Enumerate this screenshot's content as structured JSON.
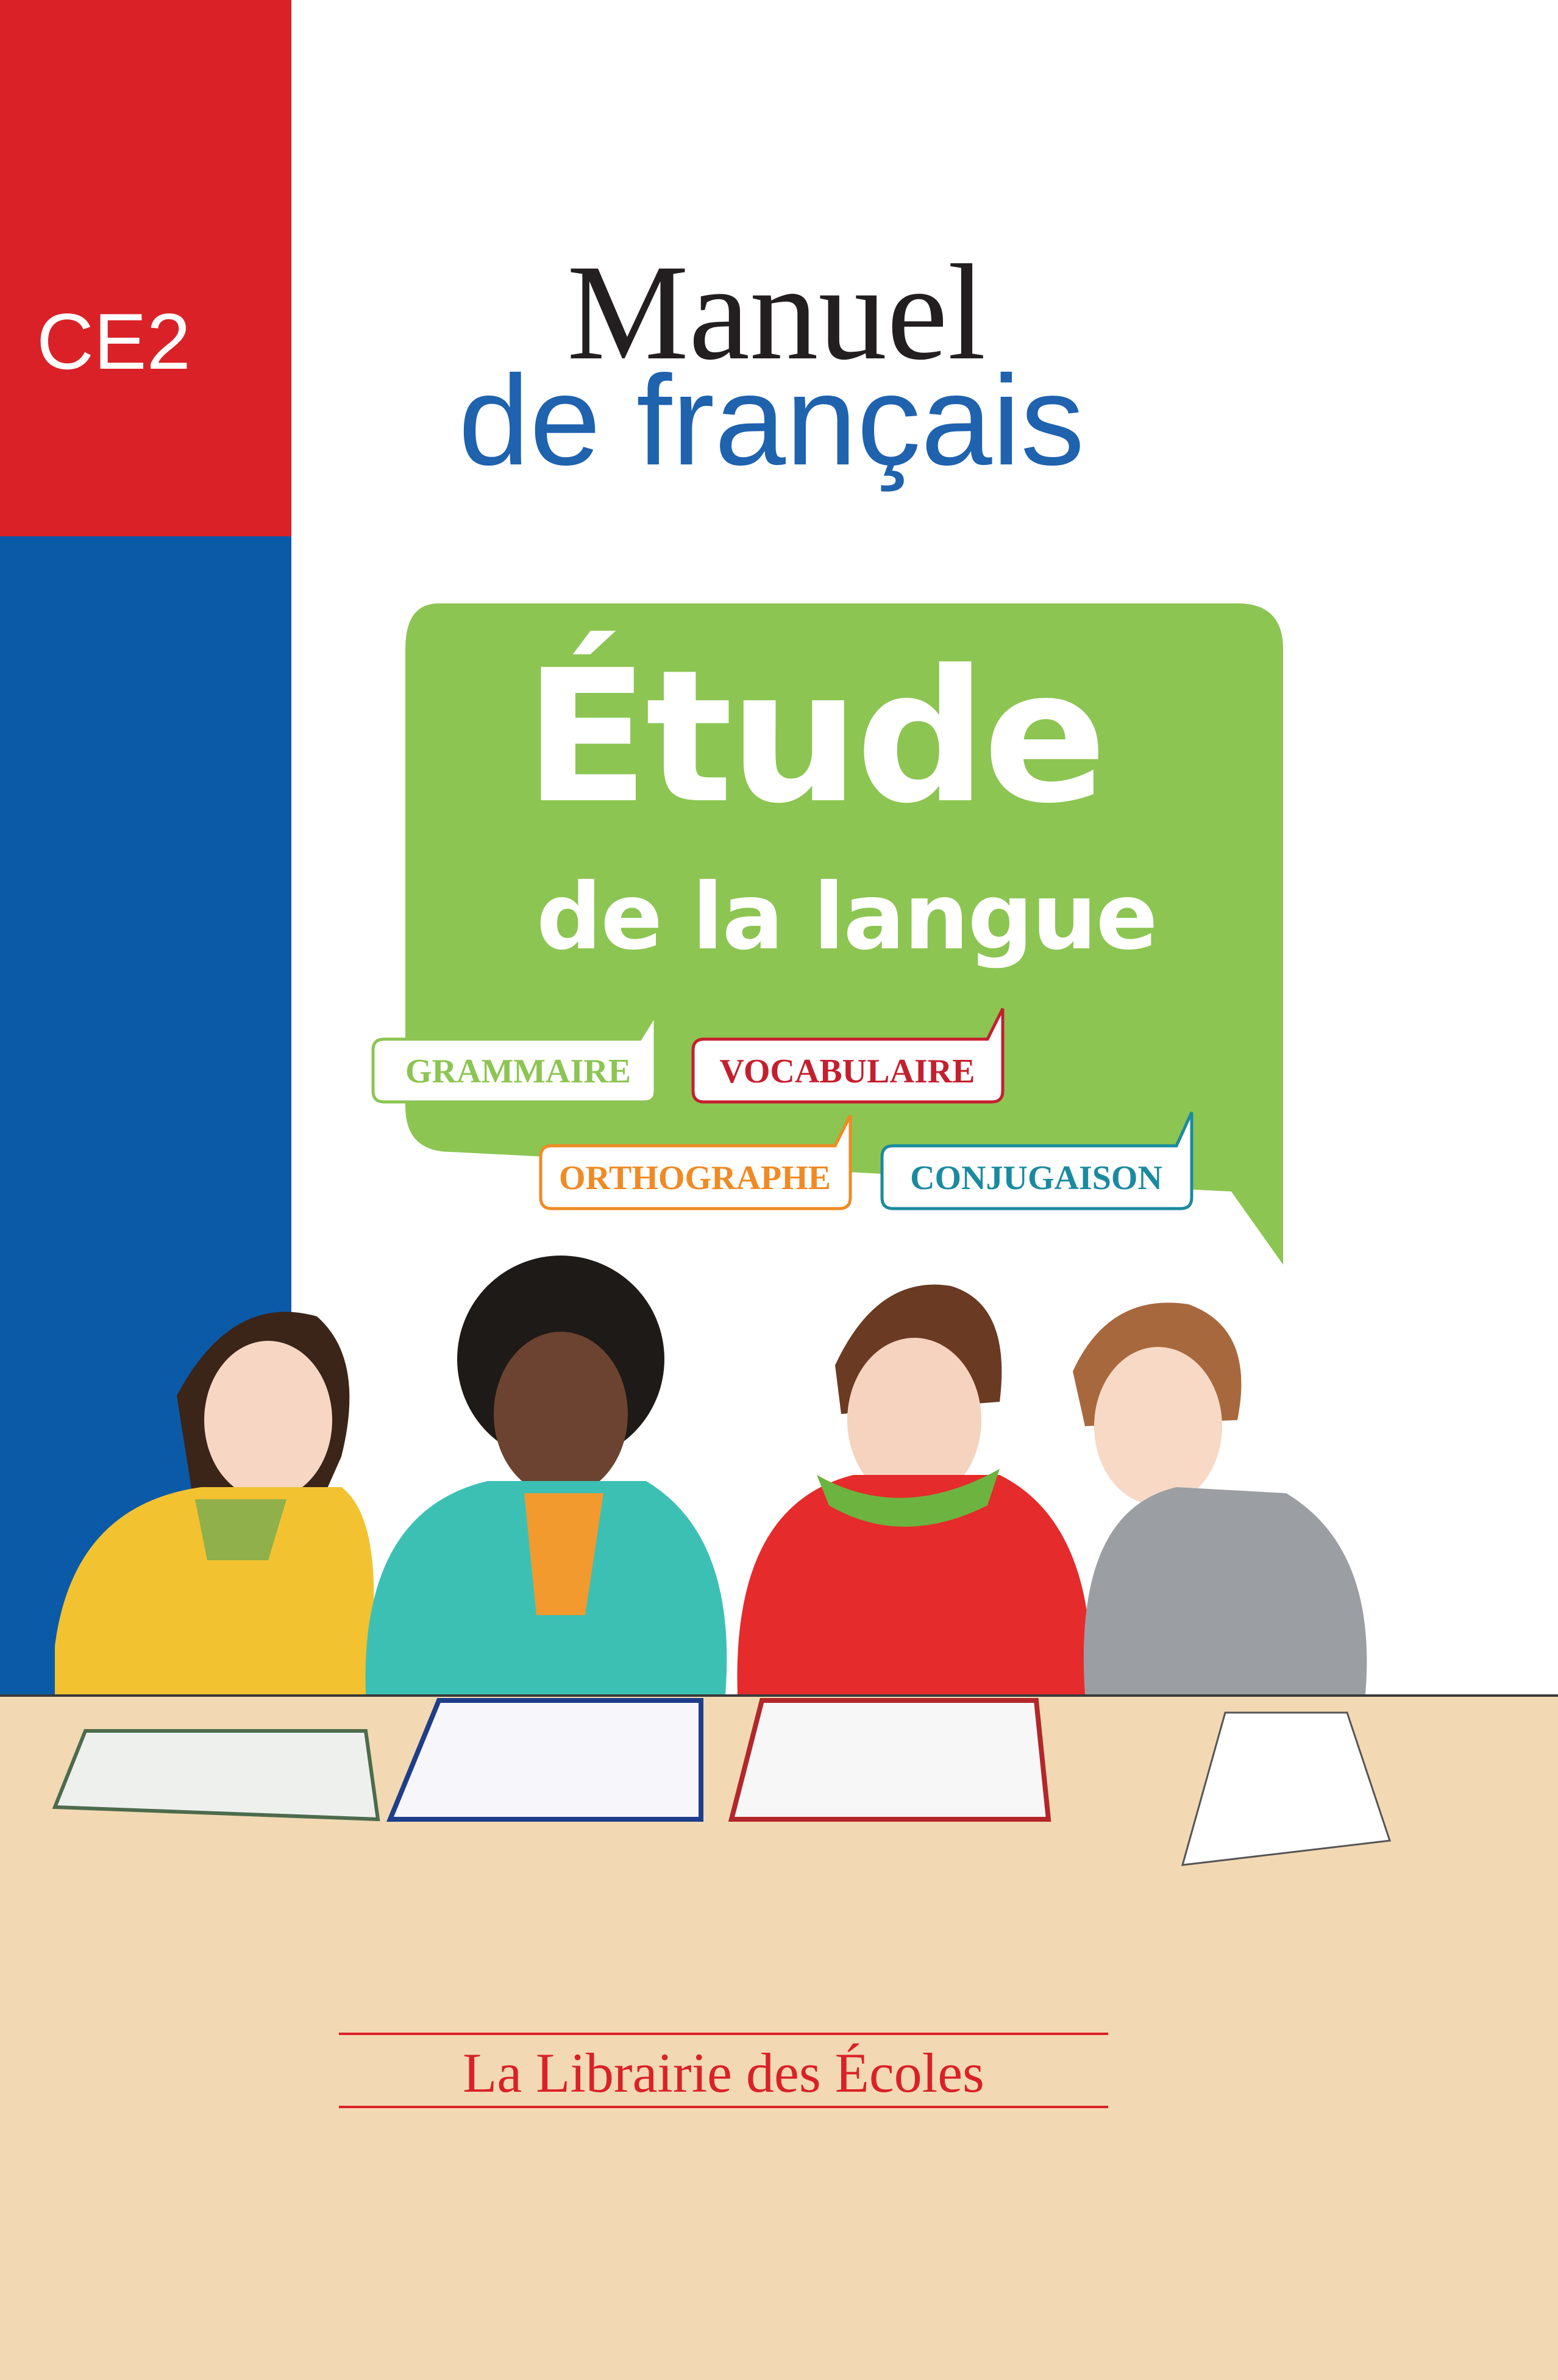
{
  "cover": {
    "grade": "CE2",
    "title_line1": "Manuel",
    "title_line2": "de français",
    "subtitle_big": "Étude",
    "subtitle_small": "de la langue",
    "tags": {
      "grammaire": "GRAMMAIRE",
      "vocabulaire": "VOCABULAIRE",
      "orthographe": "ORTHOGRAPHE",
      "conjugaison": "CONJUGAISON"
    },
    "publisher": "La Librairie des Écoles"
  },
  "colors": {
    "red": "#da2128",
    "blue": "#0b5aa8",
    "title_blue": "#1f62ae",
    "bubble_green": "#8cc552",
    "table": "#f2d9b3",
    "grammaire": "#8cc552",
    "vocabulaire": "#c41f2e",
    "orthographe": "#f08a24",
    "conjugaison": "#1b8aa0"
  },
  "illustration": {
    "icon": "four-children-at-desk-illustration"
  }
}
